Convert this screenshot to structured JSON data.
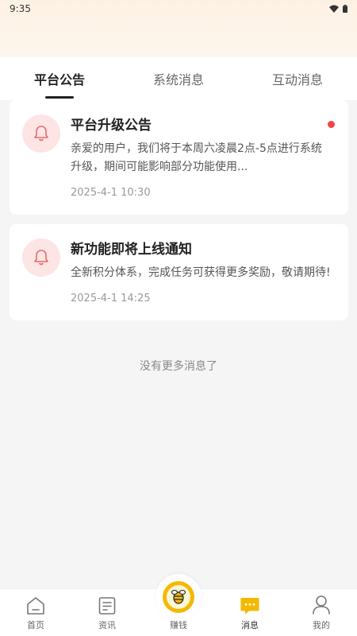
{
  "status_bar": {
    "time": "9:35"
  },
  "tabs": [
    {
      "label": "平台公告",
      "active": true
    },
    {
      "label": "系统消息",
      "active": false
    },
    {
      "label": "互动消息",
      "active": false
    }
  ],
  "messages": [
    {
      "title": "平台升级公告",
      "content": "亲爱的用户，我们将于本周六凌晨2点-5点进行系统升级，期间可能影响部分功能使用...",
      "time": "2025-4-1 10:30",
      "unread": true,
      "icon": "bell-icon"
    },
    {
      "title": "新功能即将上线通知",
      "content": "全新积分体系，完成任务可获得更多奖励，敬请期待!",
      "time": "2025-4-1 14:25",
      "unread": false,
      "icon": "bell-icon"
    }
  ],
  "no_more_text": "没有更多消息了",
  "bottom_nav": {
    "home": "首页",
    "news": "资讯",
    "earn": "赚钱",
    "messages": "消息",
    "mine": "我的",
    "active": "messages"
  },
  "colors": {
    "accent": "#f5b800",
    "unread_dot": "#f04545",
    "bell": "#e86a6a",
    "bell_bg": "#fde5e5"
  }
}
